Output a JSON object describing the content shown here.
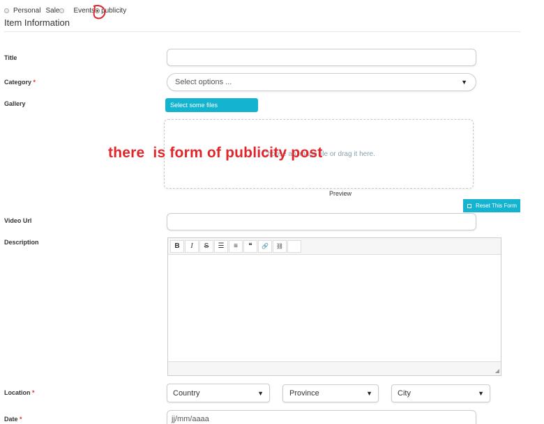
{
  "post_types": {
    "options": [
      {
        "label": "Personal",
        "checked": false
      },
      {
        "label": "Sale",
        "checked": false
      },
      {
        "label": "Events",
        "checked": false
      },
      {
        "label": "publicity",
        "checked": true
      }
    ]
  },
  "section": {
    "title": "Item Information"
  },
  "form": {
    "title": {
      "label": "Title",
      "value": ""
    },
    "category": {
      "label": "Category",
      "required_mark": "*",
      "placeholder": "Select options ..."
    },
    "gallery": {
      "label": "Gallery",
      "select_files_button": "Select some files",
      "dropzone_text": "Choose an image file or drag it here.",
      "preview_label": "Preview"
    },
    "reset_button": "Reset This Form",
    "video_url": {
      "label": "Video Url",
      "value": ""
    },
    "description": {
      "label": "Description",
      "toolbar": [
        {
          "glyph": "B",
          "icon": "bold-icon"
        },
        {
          "glyph": "I",
          "icon": "italic-icon"
        },
        {
          "glyph": "S",
          "icon": "strikethrough-icon"
        },
        {
          "glyph": "☰",
          "icon": "bullet-list-icon"
        },
        {
          "glyph": "≡",
          "icon": "numbered-list-icon"
        },
        {
          "glyph": "❝",
          "icon": "blockquote-icon"
        },
        {
          "glyph": "🔗",
          "icon": "link-icon"
        },
        {
          "glyph": "⛓",
          "icon": "unlink-icon"
        },
        {
          "glyph": "",
          "icon": "blank-button"
        }
      ]
    },
    "location": {
      "label": "Location",
      "required_mark": "*",
      "country": "Country",
      "province": "Province",
      "city": "City"
    },
    "date": {
      "label": "Date",
      "required_mark": "*",
      "placeholder": "jj/mm/aaaa"
    }
  },
  "annotation": {
    "text": "there  is form of publicity post",
    "color": "#e0262b"
  },
  "colors": {
    "accent": "#14b4d1",
    "required": "#d33333"
  }
}
